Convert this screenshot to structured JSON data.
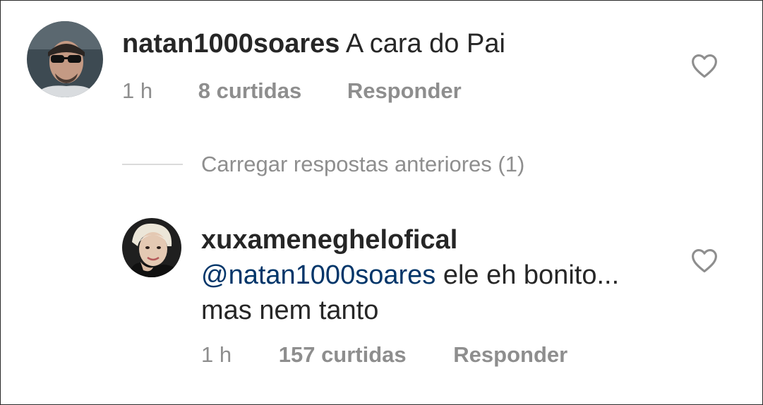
{
  "comments": [
    {
      "username": "natan1000soares",
      "text": "A cara do Pai",
      "time": "1 h",
      "likes": "8 curtidas",
      "reply_label": "Responder",
      "avatar_icon": "user-avatar-sunglasses"
    }
  ],
  "load_previous": {
    "label": "Carregar respostas anteriores (1)"
  },
  "replies": [
    {
      "username": "xuxameneghelofical",
      "mention": "@natan1000soares",
      "text_line1": " ele eh bonito...",
      "text_line2": "mas nem tanto",
      "time": "1 h",
      "likes": "157 curtidas",
      "reply_label": "Responder",
      "avatar_icon": "user-avatar-blonde"
    }
  ],
  "colors": {
    "text": "#262626",
    "meta": "#8e8e8e",
    "mention": "#003569",
    "divider": "#dbdbdb",
    "heart": "#8e8e8e"
  }
}
